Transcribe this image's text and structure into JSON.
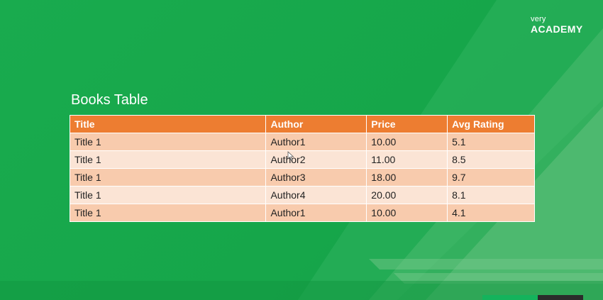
{
  "brand": {
    "small": "very",
    "big": "ACADEMY"
  },
  "slide": {
    "title": "Books Table"
  },
  "table": {
    "columns": [
      "Title",
      "Author",
      "Price",
      "Avg Rating"
    ],
    "rows": [
      [
        "Title 1",
        "Author1",
        "10.00",
        "5.1"
      ],
      [
        "Title 1",
        "Author2",
        "11.00",
        "8.5"
      ],
      [
        "Title 1",
        "Author3",
        "18.00",
        "9.7"
      ],
      [
        "Title 1",
        "Author4",
        "20.00",
        "8.1"
      ],
      [
        "Title 1",
        "Author1",
        "10.00",
        "4.1"
      ]
    ]
  },
  "colors": {
    "background": "#17a84c",
    "header": "#ed7d31",
    "row_odd": "#f8cbad",
    "row_even": "#fbe4d5"
  }
}
